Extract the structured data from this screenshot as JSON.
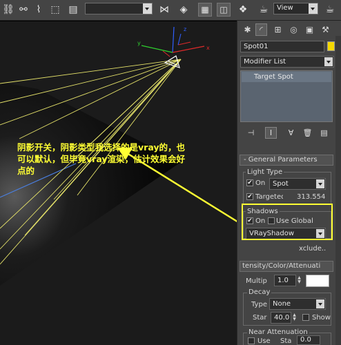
{
  "toolbar": {
    "selection_set": "",
    "viewport_mode": "View"
  },
  "annotation": {
    "lines": [
      "阴影开关，阴影类型我选择的是vray的，也",
      "可以默认，但毕竟vray渲染，估计效果会好",
      "点的"
    ]
  },
  "viewport": {
    "gizmo_y": "y",
    "gizmo_z": "z",
    "gizmo_x": "x"
  },
  "panel": {
    "object_name": "Spot01",
    "object_color": "#f5d800",
    "modifier_list": "Modifier List",
    "stack_items": [
      "Target Spot"
    ],
    "general_rollout": "General Parameters",
    "light_type": {
      "group_label": "Light Type",
      "on_label": "On",
      "on_checked": true,
      "type_value": "Spot",
      "targeted_label": "Targeted",
      "targeted_checked": true,
      "target_distance": "313.554"
    },
    "shadows": {
      "group_label": "Shadows",
      "on_label": "On",
      "on_checked": true,
      "use_global_label": "Use Global",
      "use_global_checked": false,
      "type_value": "VRayShadow",
      "exclude_label": "xclude.."
    },
    "intensity_rollout": "tensity/Color/Attenuati",
    "multiplier_label": "Multip",
    "multiplier_value": "1.0",
    "light_color": "#ffffff",
    "decay": {
      "group_label": "Decay",
      "type_label": "Type",
      "type_value": "None",
      "start_label": "Star",
      "start_value": "40.0",
      "show_label": "Show"
    },
    "near_atten": {
      "group_label": "Near Attenuation",
      "use_label": "Use",
      "start_label": "Sta",
      "start_value": "0.0"
    }
  }
}
